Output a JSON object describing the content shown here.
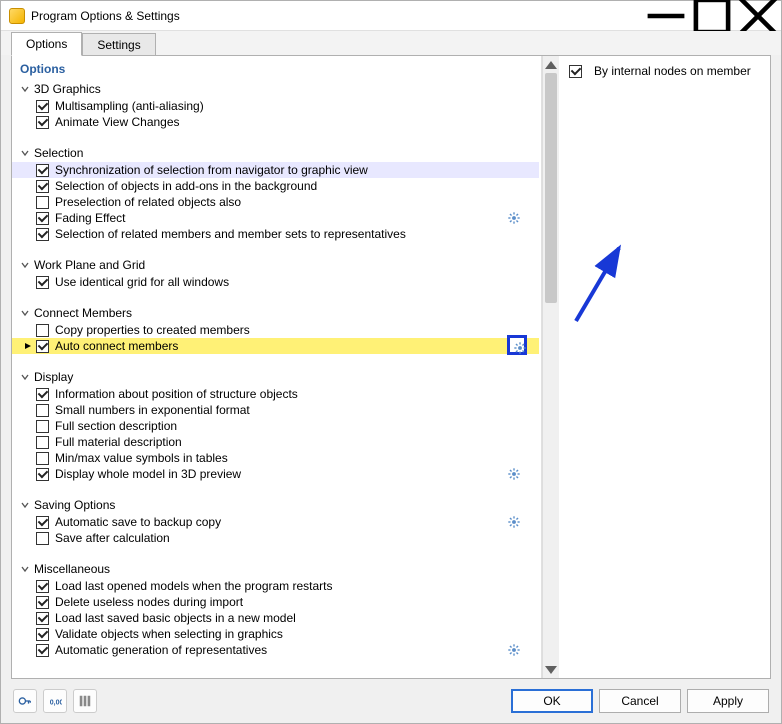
{
  "window": {
    "title": "Program Options & Settings"
  },
  "tabs": {
    "options": "Options",
    "settings": "Settings"
  },
  "panel": {
    "title": "Options"
  },
  "sections": [
    {
      "label": "3D Graphics",
      "items": [
        {
          "label": "Multisampling (anti-aliasing)",
          "checked": true
        },
        {
          "label": "Animate View Changes",
          "checked": true
        }
      ]
    },
    {
      "label": "Selection",
      "items": [
        {
          "label": "Synchronization of selection from navigator to graphic view",
          "checked": true,
          "selbg": true
        },
        {
          "label": "Selection of objects in add-ons in the background",
          "checked": true
        },
        {
          "label": "Preselection of related objects also",
          "checked": false
        },
        {
          "label": "Fading Effect",
          "checked": true,
          "gear": true
        },
        {
          "label": "Selection of related members and member sets to representatives",
          "checked": true
        }
      ]
    },
    {
      "label": "Work Plane and Grid",
      "items": [
        {
          "label": "Use identical grid for all windows",
          "checked": true
        }
      ]
    },
    {
      "label": "Connect Members",
      "items": [
        {
          "label": "Copy properties to created members",
          "checked": false
        },
        {
          "label": "Auto connect members",
          "checked": true,
          "highlight": true,
          "gear": true,
          "gearBoxed": true,
          "playmark": true
        }
      ]
    },
    {
      "label": "Display",
      "items": [
        {
          "label": "Information about position of structure objects",
          "checked": true
        },
        {
          "label": "Small numbers in exponential format",
          "checked": false
        },
        {
          "label": "Full section description",
          "checked": false
        },
        {
          "label": "Full material description",
          "checked": false
        },
        {
          "label": "Min/max value symbols in tables",
          "checked": false
        },
        {
          "label": "Display whole model in 3D preview",
          "checked": true,
          "gear": true
        }
      ]
    },
    {
      "label": "Saving Options",
      "items": [
        {
          "label": "Automatic save to backup copy",
          "checked": true,
          "gear": true
        },
        {
          "label": "Save after calculation",
          "checked": false
        }
      ]
    },
    {
      "label": "Miscellaneous",
      "items": [
        {
          "label": "Load last opened models when the program restarts",
          "checked": true
        },
        {
          "label": "Delete useless nodes during import",
          "checked": true
        },
        {
          "label": "Load last saved basic objects in a new model",
          "checked": true
        },
        {
          "label": "Validate objects when selecting in graphics",
          "checked": true
        },
        {
          "label": "Automatic generation of representatives",
          "checked": true,
          "gear": true
        }
      ]
    }
  ],
  "right": {
    "checkbox_label": "By internal nodes on member",
    "checked": true
  },
  "buttons": {
    "ok": "OK",
    "cancel": "Cancel",
    "apply": "Apply"
  },
  "icons": {
    "key": "key-icon",
    "units": "units-icon",
    "columns": "columns-icon",
    "min": "minimize-icon",
    "max": "maximize-icon",
    "close": "close-icon"
  }
}
